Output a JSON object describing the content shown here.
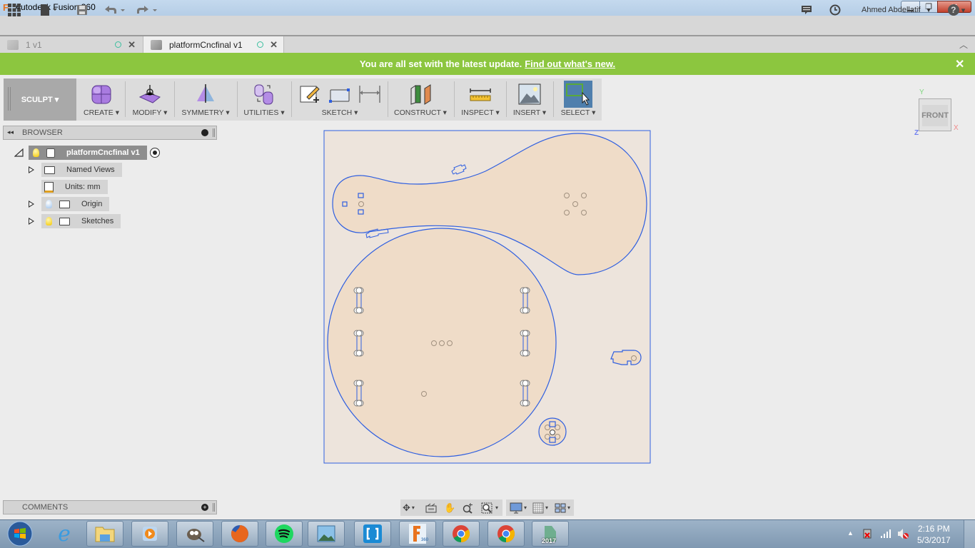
{
  "window": {
    "title": "Autodesk Fusion 360",
    "logo_letter": "F",
    "minimize": "▁",
    "maximize": "❐",
    "close": "✕"
  },
  "quick_access": {
    "user_name": "Ahmed Abdellatif",
    "user_caret": "▼",
    "help": "?",
    "help_caret": "▾"
  },
  "tabs": [
    {
      "label": "1 v1",
      "active": false
    },
    {
      "label": "platformCncfinal v1",
      "active": true
    }
  ],
  "notification": {
    "message": "You are all set with the latest update.",
    "link": "Find out what's new.",
    "close": "✕",
    "bg_color": "#8cc63f"
  },
  "toolbar": {
    "workspace": "SCULPT ▾",
    "groups": [
      {
        "label": "CREATE ▾"
      },
      {
        "label": "MODIFY ▾"
      },
      {
        "label": "SYMMETRY ▾"
      },
      {
        "label": "UTILITIES ▾"
      },
      {
        "label": "SKETCH ▾"
      },
      {
        "label": "CONSTRUCT ▾"
      },
      {
        "label": "INSPECT ▾"
      },
      {
        "label": "INSERT ▾"
      },
      {
        "label": "SELECT ▾"
      }
    ]
  },
  "browser": {
    "title": "BROWSER",
    "root": "platformCncfinal v1",
    "items": [
      {
        "label": "Named Views"
      },
      {
        "label": "Units: mm"
      },
      {
        "label": "Origin"
      },
      {
        "label": "Sketches"
      }
    ]
  },
  "comments": {
    "title": "COMMENTS"
  },
  "viewcube": {
    "face": "FRONT",
    "x": "X",
    "y": "Y",
    "z": "Z"
  },
  "taskbar": {
    "time": "2:16 PM",
    "date": "5/3/2017",
    "apps": [
      "Start",
      "Internet Explorer",
      "File Explorer",
      "Media Player",
      "GIMP",
      "Firefox",
      "Spotify",
      "Photos",
      "Brackets",
      "Fusion 360",
      "Chrome",
      "Chrome",
      "3ds Max 2017"
    ],
    "badge_2017": "2017",
    "badge_360": "360"
  },
  "colors": {
    "sketch_line": "#2f5fe0",
    "profile_fill": "#efdcc8",
    "sheet_fill": "#ede4dc",
    "select_active": "#4f7fad"
  }
}
